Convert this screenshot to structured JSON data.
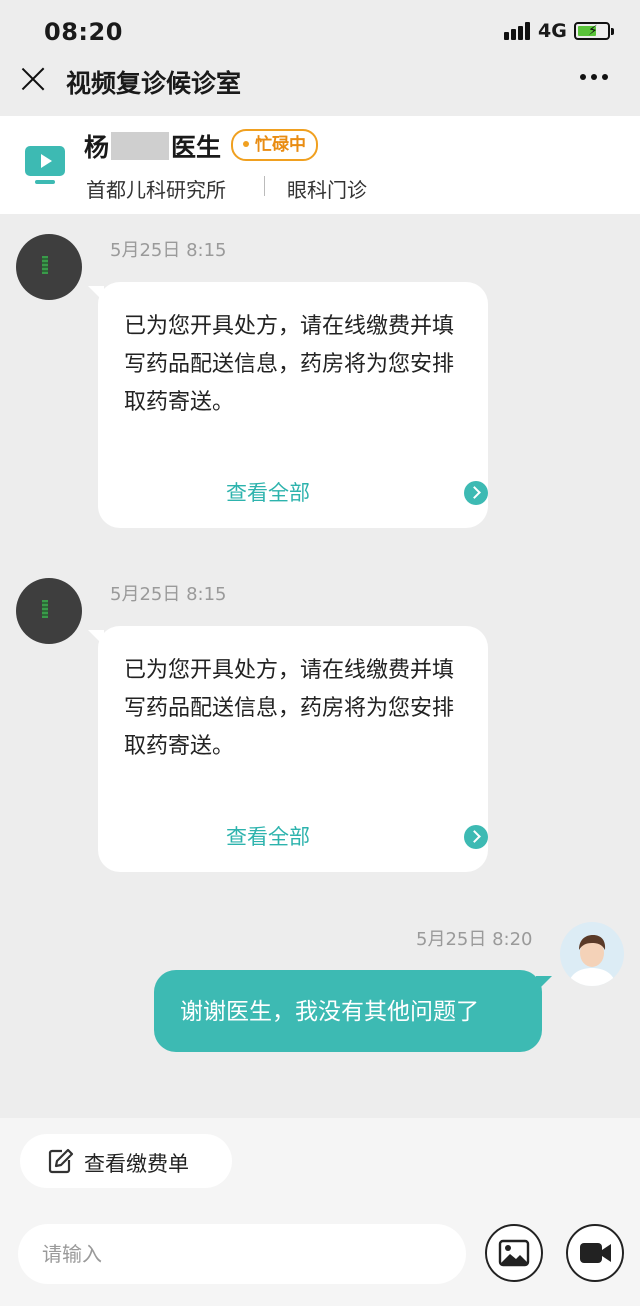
{
  "status_bar": {
    "time": "08:20",
    "network": "4G"
  },
  "nav": {
    "title": "视频复诊候诊室"
  },
  "doctor": {
    "name_prefix": "杨",
    "name_suffix": "医生",
    "status": "忙碌中",
    "hospital": "首都儿科研究所",
    "department": "眼科门诊"
  },
  "messages": [
    {
      "time": "5月25日  8:15",
      "text": "已为您开具处方，请在线缴费并填写药品配送信息，药房将为您安排取药寄送。",
      "action": "查看全部"
    },
    {
      "time": "5月25日  8:15",
      "text": "已为您开具处方，请在线缴费并填写药品配送信息，药房将为您安排取药寄送。",
      "action": "查看全部"
    },
    {
      "time": "5月25日  8:20",
      "text": "谢谢医生，我没有其他问题了"
    }
  ],
  "bottom": {
    "bill_button": "查看缴费单",
    "input_placeholder": "请输入"
  },
  "colors": {
    "accent": "#3dbab3",
    "busy": "#f0a020",
    "battery": "#5ac43a"
  }
}
